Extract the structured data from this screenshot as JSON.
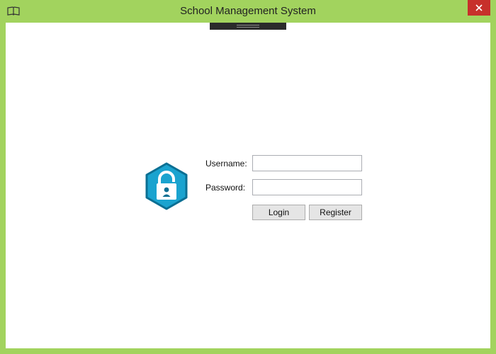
{
  "window": {
    "title": "School Management System",
    "app_icon": "book-icon",
    "close_icon": "close-icon"
  },
  "login_form": {
    "lock_icon": "lock-icon",
    "username_label": "Username:",
    "username_value": "",
    "password_label": "Password:",
    "password_value": "",
    "login_label": "Login",
    "register_label": "Register"
  },
  "colors": {
    "window_frame": "#a2d35e",
    "close_button": "#c7302b",
    "lock_fill": "#1aa3cf",
    "lock_stroke": "#0b6f93"
  }
}
